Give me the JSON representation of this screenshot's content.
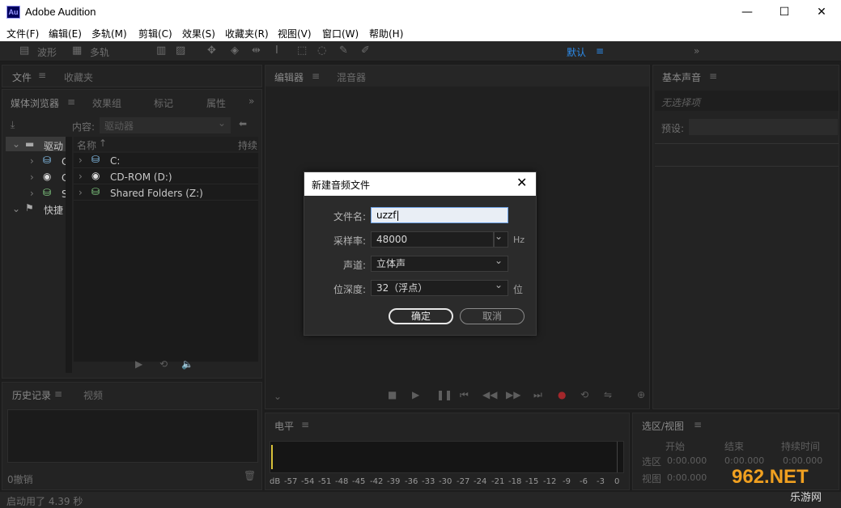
{
  "window": {
    "app_icon": "Au",
    "title": "Adobe Audition",
    "minimize": "—",
    "maximize": "☐",
    "close": "✕"
  },
  "menu": [
    "文件(F)",
    "编辑(E)",
    "多轨(M)",
    "剪辑(C)",
    "效果(S)",
    "收藏夹(R)",
    "视图(V)",
    "窗口(W)",
    "帮助(H)"
  ],
  "toolbar": {
    "waveform": "波形",
    "multitrack": "多轨",
    "workspace": "默认",
    "more": "»"
  },
  "files_panel": {
    "tabs": [
      "文件",
      "收藏夹"
    ]
  },
  "media_browser": {
    "tabs": [
      "媒体浏览器",
      "效果组",
      "标记",
      "属性"
    ],
    "more": "»",
    "content_label": "内容:",
    "content_value": "驱动器",
    "left_tree": [
      "驱动",
      "C",
      "C",
      "S",
      "快捷"
    ],
    "col_name": "名称",
    "col_duration": "持续",
    "items": [
      "C:",
      "CD-ROM (D:)",
      "Shared Folders (Z:)"
    ]
  },
  "history_panel": {
    "tabs": [
      "历史记录",
      "视频"
    ],
    "undo_count": "0撤销"
  },
  "status_bar": {
    "text": "启动用了 4.39 秒"
  },
  "editor_panel": {
    "tabs": [
      "编辑器",
      "混音器"
    ]
  },
  "essential_sound": {
    "title": "基本声音",
    "no_selection": "无选择项",
    "preset_label": "预设:"
  },
  "level_panel": {
    "title": "电平",
    "scale": [
      "dB",
      "-57",
      "-54",
      "-51",
      "-48",
      "-45",
      "-42",
      "-39",
      "-36",
      "-33",
      "-30",
      "-27",
      "-24",
      "-21",
      "-18",
      "-15",
      "-12",
      "-9",
      "-6",
      "-3",
      "0"
    ]
  },
  "selection_panel": {
    "title": "选区/视图",
    "cols": [
      "开始",
      "结束",
      "持续时间"
    ],
    "rows": [
      {
        "label": "选区",
        "start": "0:00.000",
        "end": "0:00.000",
        "duration": "0:00.000"
      },
      {
        "label": "视图",
        "start": "0:00.000",
        "end": "",
        "duration": ""
      }
    ]
  },
  "watermark": {
    "line1": "962.NET",
    "line2": "乐游网"
  },
  "dialog": {
    "title": "新建音频文件",
    "filename_label": "文件名:",
    "filename_value": "uzzf",
    "samplerate_label": "采样率:",
    "samplerate_value": "48000",
    "samplerate_unit": "Hz",
    "channels_label": "声道:",
    "channels_value": "立体声",
    "bitdepth_label": "位深度:",
    "bitdepth_value": "32（浮点）",
    "bitdepth_unit": "位",
    "ok": "确定",
    "cancel": "取消"
  }
}
